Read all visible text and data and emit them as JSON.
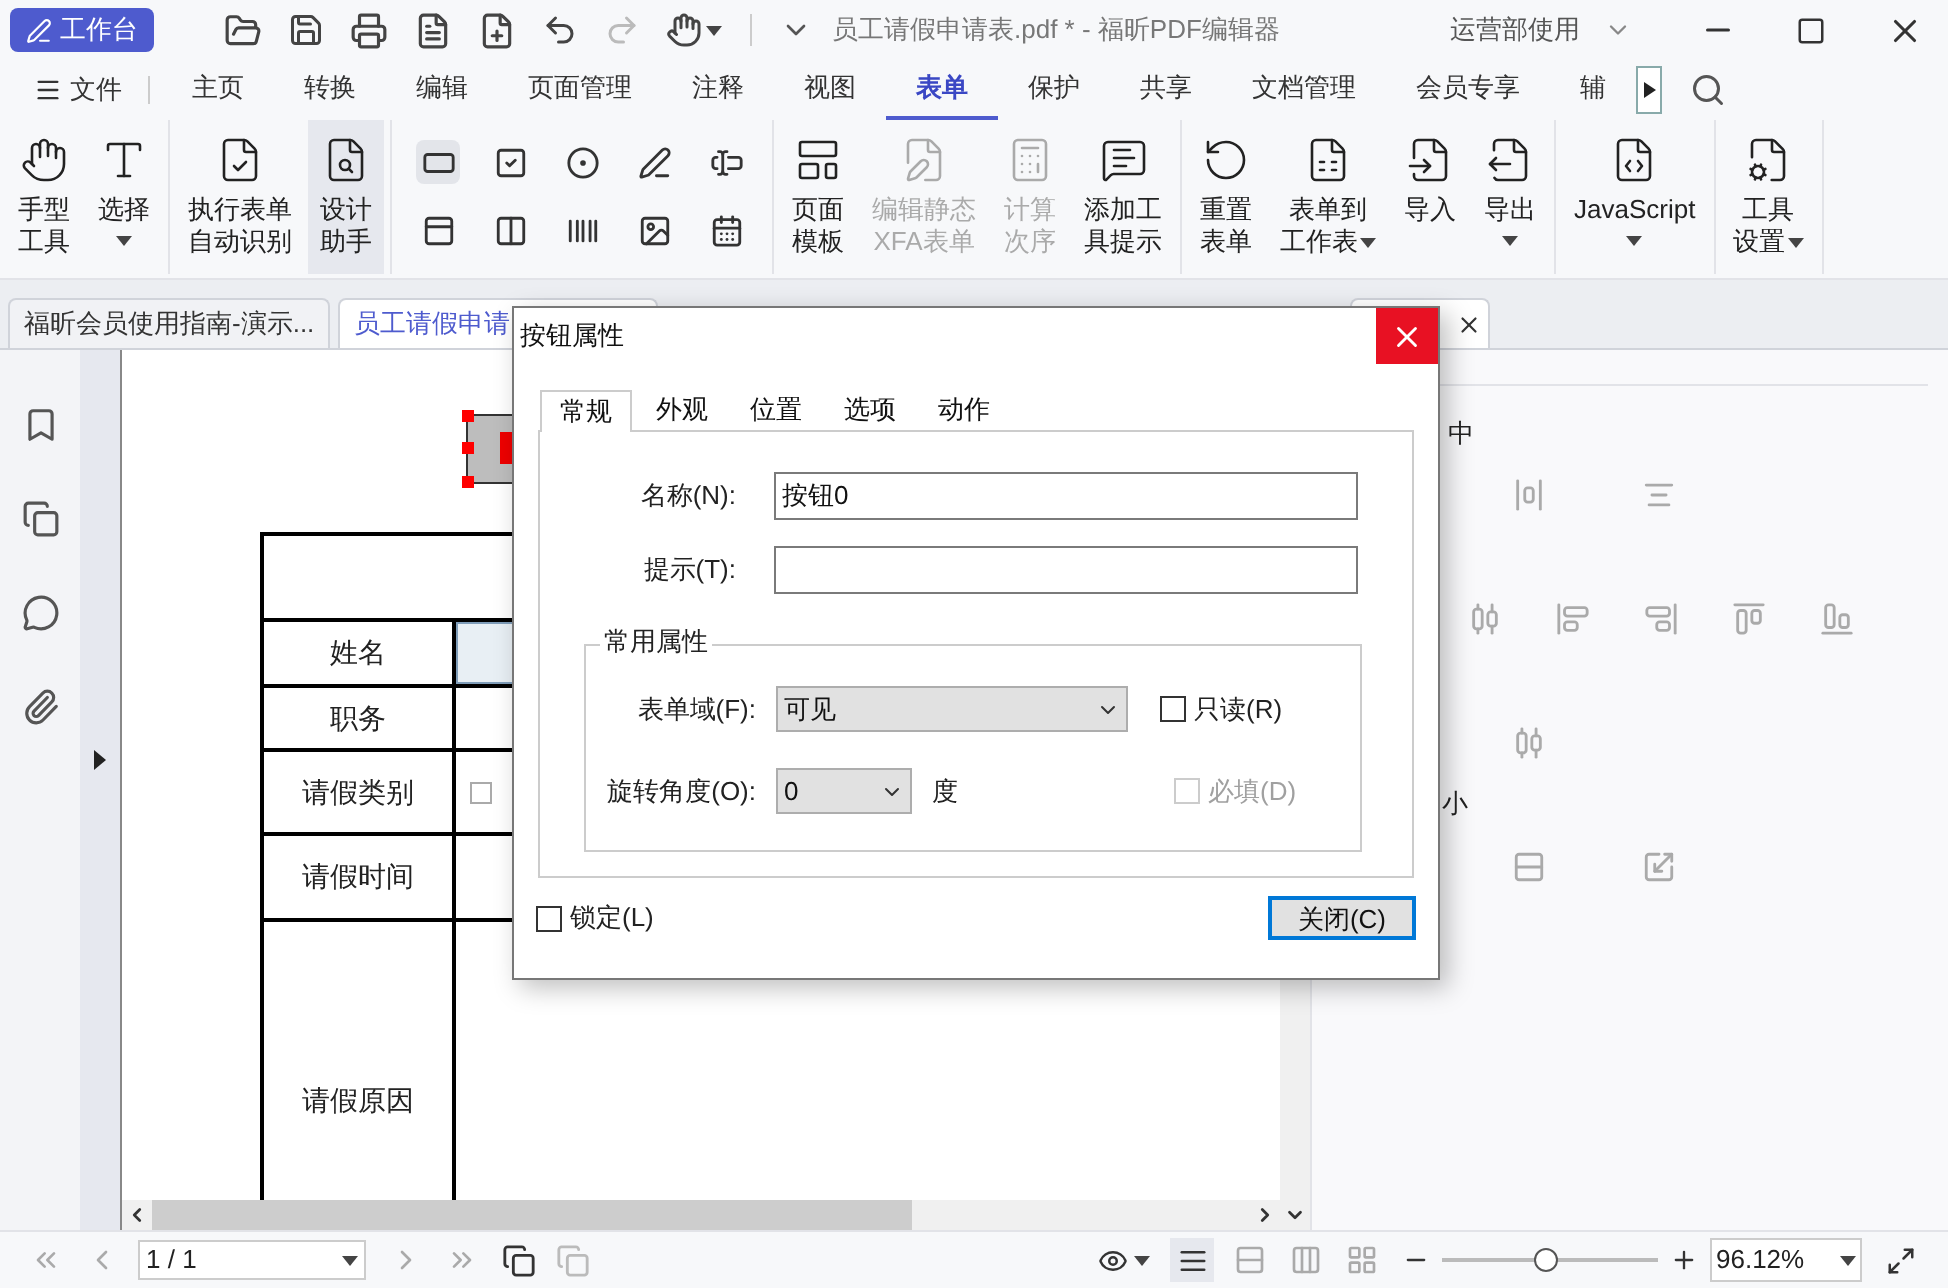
{
  "titlebar": {
    "workspace_button": "工作台",
    "title": "员工请假申请表.pdf * - 福昕PDF编辑器",
    "account": "运营部使用"
  },
  "menu": {
    "file": "文件",
    "tabs": [
      {
        "label": "主页",
        "selected": false
      },
      {
        "label": "转换",
        "selected": false
      },
      {
        "label": "编辑",
        "selected": false
      },
      {
        "label": "页面管理",
        "selected": false
      },
      {
        "label": "注释",
        "selected": false
      },
      {
        "label": "视图",
        "selected": false
      },
      {
        "label": "表单",
        "selected": true
      },
      {
        "label": "保护",
        "selected": false
      },
      {
        "label": "共享",
        "selected": false
      },
      {
        "label": "文档管理",
        "selected": false
      },
      {
        "label": "会员专享",
        "selected": false
      },
      {
        "label": "辅",
        "selected": false
      }
    ]
  },
  "ribbon": {
    "groups": [
      {
        "kind": "tools",
        "items": [
          {
            "lines": [
              "手型",
              "工具"
            ],
            "caret": false,
            "disabled": false,
            "selected": false
          },
          {
            "lines": [
              "选择"
            ],
            "caret": true,
            "disabled": false,
            "selected": false
          }
        ]
      },
      {
        "kind": "tools",
        "items": [
          {
            "lines": [
              "执行表单",
              "自动识别"
            ],
            "caret": false,
            "disabled": false,
            "selected": false
          },
          {
            "lines": [
              "设计",
              "助手"
            ],
            "caret": false,
            "disabled": false,
            "selected": true
          }
        ]
      },
      {
        "kind": "field_icons"
      },
      {
        "kind": "tools",
        "items": [
          {
            "lines": [
              "页面",
              "模板"
            ],
            "caret": false,
            "disabled": false,
            "selected": false
          },
          {
            "lines": [
              "编辑静态",
              "XFA表单"
            ],
            "caret": false,
            "disabled": true,
            "selected": false
          },
          {
            "lines": [
              "计算",
              "次序"
            ],
            "caret": false,
            "disabled": true,
            "selected": false
          },
          {
            "lines": [
              "添加工",
              "具提示"
            ],
            "caret": false,
            "disabled": false,
            "selected": false
          }
        ]
      },
      {
        "kind": "tools",
        "items": [
          {
            "lines": [
              "重置",
              "表单"
            ],
            "caret": false,
            "disabled": false,
            "selected": false
          },
          {
            "lines": [
              "表单到",
              "工作表"
            ],
            "caret": true,
            "disabled": false,
            "selected": false
          },
          {
            "lines": [
              "导入"
            ],
            "caret": false,
            "disabled": false,
            "selected": false
          },
          {
            "lines": [
              "导出"
            ],
            "caret": true,
            "disabled": false,
            "selected": false
          }
        ]
      },
      {
        "kind": "tools",
        "items": [
          {
            "lines": [
              "JavaScript"
            ],
            "caret": true,
            "disabled": false,
            "selected": false
          }
        ]
      },
      {
        "kind": "tools",
        "items": [
          {
            "lines": [
              "工具",
              "设置"
            ],
            "caret": true,
            "disabled": false,
            "selected": false
          }
        ]
      }
    ]
  },
  "doc_tabs": [
    {
      "label": "福昕会员使用指南-演示...",
      "selected": false
    },
    {
      "label": "员工请假申请",
      "selected": true
    }
  ],
  "form": {
    "rows": [
      {
        "label": "姓名",
        "kind": "field"
      },
      {
        "label": "职务",
        "kind": "blank"
      },
      {
        "label": "请假类别",
        "kind": "checkbox",
        "checked": false
      },
      {
        "label": "请假时间",
        "kind": "blank"
      },
      {
        "label": "请假原因",
        "kind": "blank"
      }
    ]
  },
  "right_panel": {
    "headings": [
      "中",
      "小"
    ]
  },
  "dialog": {
    "title": "按钮属性",
    "tabs": [
      {
        "label": "常规",
        "selected": true
      },
      {
        "label": "外观",
        "selected": false
      },
      {
        "label": "位置",
        "selected": false
      },
      {
        "label": "选项",
        "selected": false
      },
      {
        "label": "动作",
        "selected": false
      }
    ],
    "name_label": "名称(N):",
    "name_value": "按钮0",
    "tooltip_label": "提示(T):",
    "group_title": "常用属性",
    "form_field_label": "表单域(F):",
    "form_field_value": "可见",
    "readonly": {
      "label": "只读(R)",
      "checked": false,
      "disabled": false
    },
    "rotation_label": "旋转角度(O):",
    "rotation_value": "0",
    "rotation_unit": "度",
    "required": {
      "label": "必填(D)",
      "checked": false,
      "disabled": true
    },
    "lock": {
      "label": "锁定(L)",
      "checked": false
    },
    "close_button": "关闭(C)"
  },
  "status": {
    "page": "1 / 1",
    "zoom": "96.12%",
    "zoom_slider": {
      "level": 0.48
    }
  }
}
